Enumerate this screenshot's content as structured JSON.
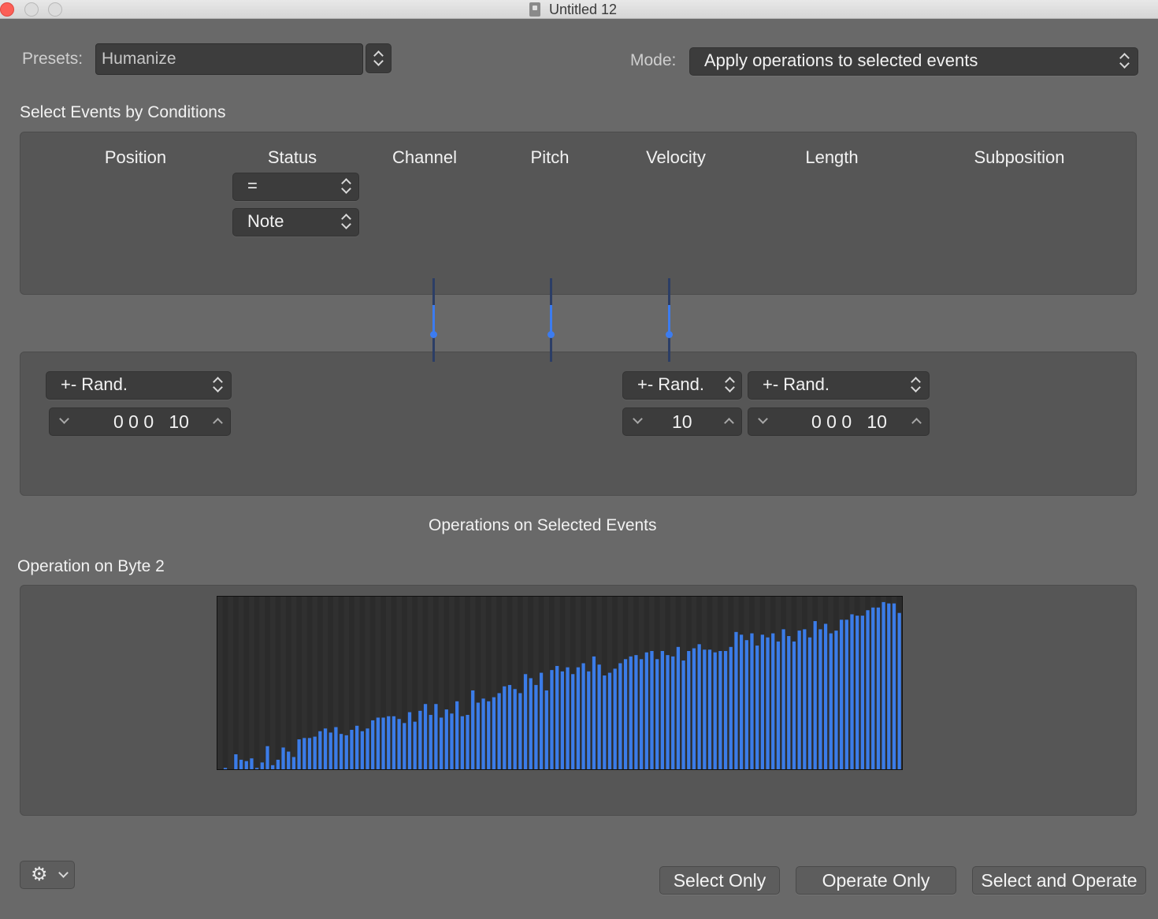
{
  "window": {
    "title": "Untitled 12"
  },
  "header": {
    "presets_label": "Presets:",
    "presets_value": "Humanize",
    "mode_label": "Mode:",
    "mode_value": "Apply operations to selected events"
  },
  "conditions": {
    "title": "Select Events by Conditions",
    "columns": [
      "Position",
      "Status",
      "Channel",
      "Pitch",
      "Velocity",
      "Length",
      "Subposition"
    ],
    "status_operator": "=",
    "status_value": "Note"
  },
  "operations": {
    "position": {
      "operator": "+- Rand.",
      "value": "0 0 0   10"
    },
    "velocity": {
      "operator": "+- Rand.",
      "value": "10"
    },
    "length": {
      "operator": "+- Rand.",
      "value": "0 0 0   10"
    }
  },
  "ops_section_title": "Operations on Selected Events",
  "byte2": {
    "title": "Operation on Byte 2",
    "bar_color": "#3b7ce8",
    "background_color": "#2b2b2b"
  },
  "chart_data": {
    "type": "bar",
    "title": "",
    "xlabel": "",
    "ylabel": "",
    "ylim": [
      0,
      127
    ],
    "values": [
      0,
      1,
      0,
      11,
      7,
      6,
      8,
      1,
      5,
      17,
      3,
      7,
      16,
      13,
      9,
      22,
      23,
      23,
      24,
      28,
      30,
      27,
      31,
      26,
      25,
      29,
      32,
      28,
      30,
      36,
      38,
      38,
      39,
      39,
      37,
      34,
      42,
      35,
      43,
      48,
      40,
      48,
      38,
      44,
      41,
      50,
      39,
      40,
      58,
      49,
      52,
      50,
      53,
      56,
      61,
      62,
      59,
      56,
      70,
      67,
      62,
      71,
      58,
      73,
      76,
      72,
      75,
      70,
      75,
      78,
      72,
      83,
      77,
      69,
      71,
      74,
      78,
      81,
      83,
      84,
      81,
      86,
      87,
      81,
      87,
      84,
      83,
      90,
      80,
      87,
      89,
      92,
      88,
      88,
      86,
      87,
      87,
      90,
      101,
      99,
      95,
      100,
      91,
      99,
      97,
      100,
      94,
      103,
      98,
      94,
      102,
      103,
      97,
      109,
      103,
      107,
      100,
      102,
      110,
      110,
      114,
      113,
      113,
      117,
      119,
      119,
      123,
      122,
      122,
      115
    ]
  },
  "footer": {
    "gear_icon": "gear-icon",
    "select_only": "Select Only",
    "operate_only": "Operate Only",
    "select_and_operate": "Select and Operate"
  }
}
